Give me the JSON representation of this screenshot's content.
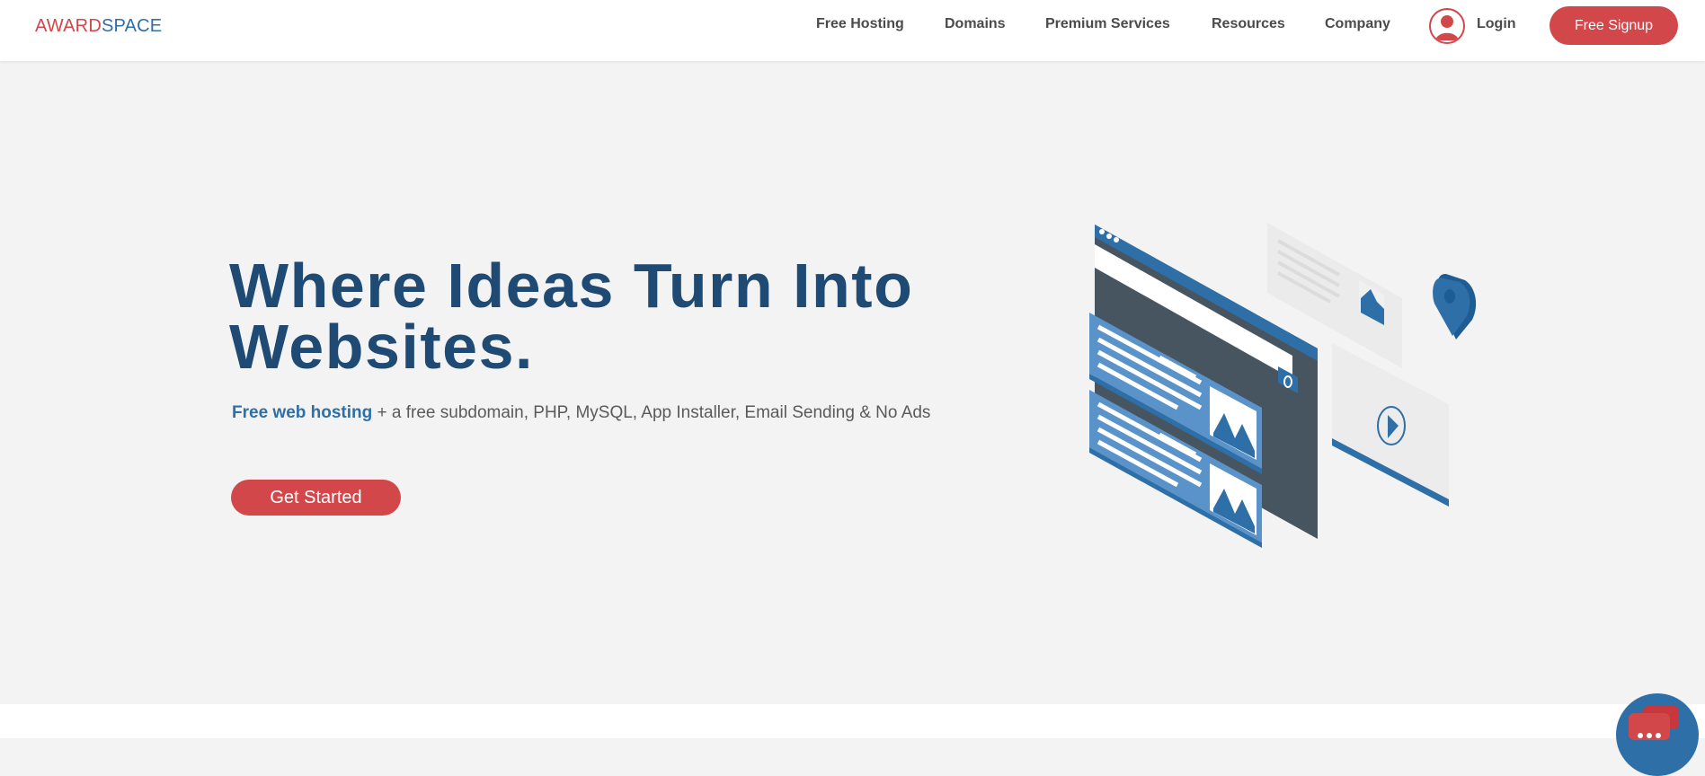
{
  "brand": {
    "part1": "AWARD",
    "part2": "SPACE"
  },
  "nav": {
    "items": [
      {
        "label": "Free Hosting"
      },
      {
        "label": "Domains"
      },
      {
        "label": "Premium Services"
      },
      {
        "label": "Resources"
      },
      {
        "label": "Company"
      }
    ],
    "login_label": "Login",
    "signup_label": "Free Signup"
  },
  "hero": {
    "title": "Where Ideas Turn Into Websites.",
    "subtitle_highlight": "Free web hosting",
    "subtitle_rest": " + a free subdomain, PHP, MySQL, App Installer, Email Sending & No Ads",
    "cta_label": "Get Started"
  },
  "colors": {
    "accent_red": "#d2474a",
    "brand_blue": "#2e6fa7",
    "title_navy": "#1f4a73",
    "hero_bg": "#f3f3f3"
  },
  "icons": {
    "login": "user-avatar-icon",
    "chat": "chat-bubble-icon",
    "location": "location-pin-icon",
    "play": "play-icon"
  }
}
